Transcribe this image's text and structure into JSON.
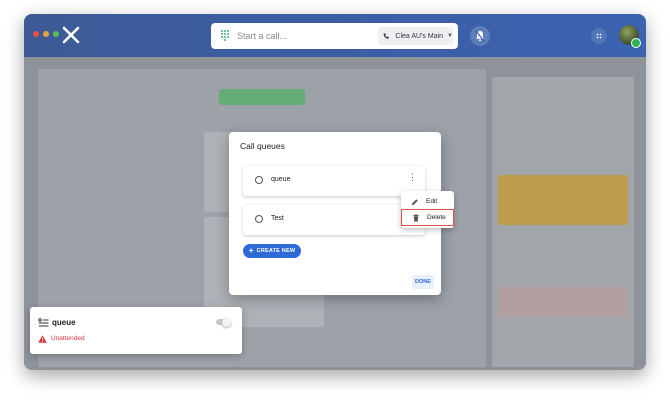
{
  "colors": {
    "topbar": "#3a63b1",
    "accent": "#2f6bd6",
    "danger": "#d9363e",
    "highlight_border": "#d9534f",
    "dot_red": "#e8524a",
    "dot_yellow": "#e0a83a",
    "dot_green": "#5fba55"
  },
  "topbar": {
    "search_placeholder": "Start a call...",
    "line_label": "Clea AU's Main",
    "icons": [
      "dialpad-icon",
      "phone-icon",
      "chevron-down-icon",
      "bell-off-icon",
      "apps-grid-icon"
    ]
  },
  "modal": {
    "title": "Call queues",
    "queues": [
      {
        "name": "queue"
      },
      {
        "name": "Test"
      }
    ],
    "create_label": "CREATE NEW",
    "done_label": "DONE"
  },
  "context_menu": {
    "edit_label": "Edit",
    "delete_label": "Delete"
  },
  "toast": {
    "queue_name": "queue",
    "status": "Unattended",
    "toggle_on": false
  }
}
